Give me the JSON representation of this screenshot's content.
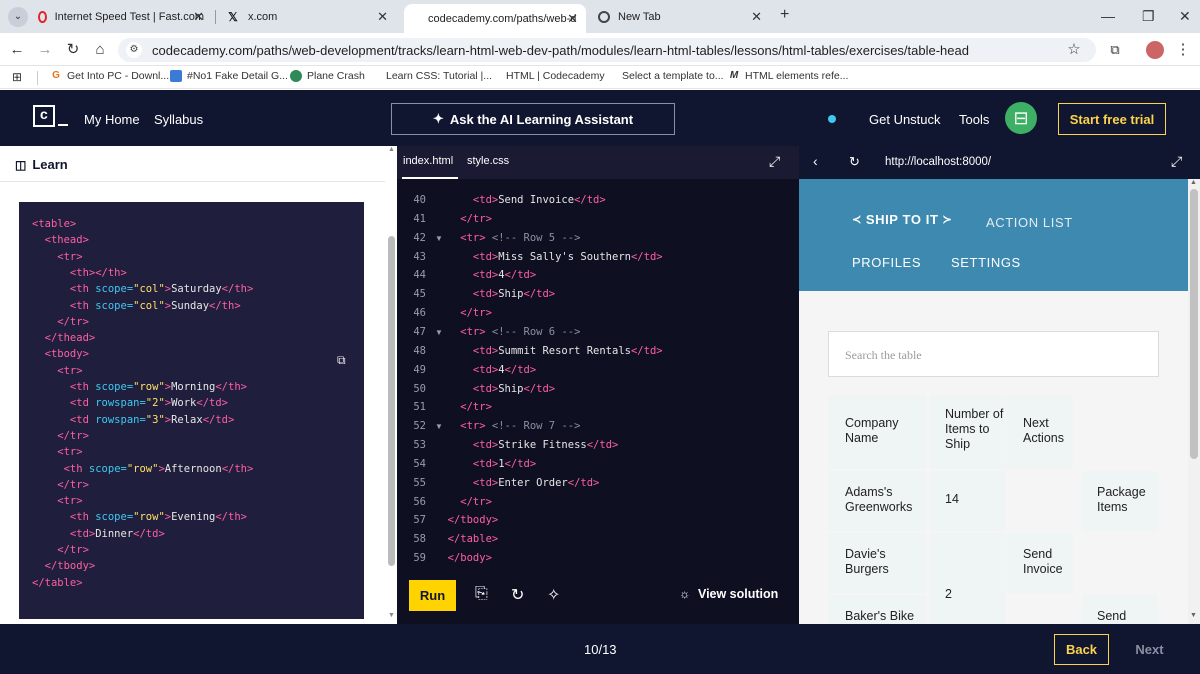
{
  "browser": {
    "tabs": [
      {
        "label": "Internet Speed Test | Fast.com",
        "icon": "fast-com-icon"
      },
      {
        "label": "x.com",
        "icon": "x-logo-icon"
      },
      {
        "label": "codecademy.com/paths/web-d",
        "icon": "codecademy-icon",
        "active": true
      },
      {
        "label": "New Tab",
        "icon": "chrome-icon"
      }
    ],
    "url": "codecademy.com/paths/web-development/tracks/learn-html-web-dev-path/modules/learn-html-tables/lessons/html-tables/exercises/table-head",
    "bookmarks": [
      {
        "label": "Get Into PC - Downl...",
        "icon": "G"
      },
      {
        "label": "#No1 Fake Detail G...",
        "icon": "fake-detail-icon"
      },
      {
        "label": "Plane Crash",
        "icon": "plane-crash-icon"
      },
      {
        "label": "Learn CSS: Tutorial |...",
        "icon": ""
      },
      {
        "label": "HTML | Codecademy",
        "icon": ""
      },
      {
        "label": "Select a template to...",
        "icon": ""
      },
      {
        "label": "HTML elements refe...",
        "icon": "M"
      }
    ]
  },
  "header": {
    "my_home": "My Home",
    "syllabus": "Syllabus",
    "ai_assistant": "Ask the AI Learning Assistant",
    "get_unstuck": "Get Unstuck",
    "tools": "Tools",
    "start_trial": "Start free trial"
  },
  "learn": {
    "title": "Learn",
    "code_lines": [
      [
        [
          "tg",
          "<table>"
        ]
      ],
      [
        [
          "tg",
          "  <thead>"
        ]
      ],
      [
        [
          "tg",
          "    <tr>"
        ]
      ],
      [
        [
          "tg",
          "      <th></th>"
        ]
      ],
      [
        [
          "tg",
          "      <th "
        ],
        [
          "at",
          "scope="
        ],
        [
          "st",
          "\"col\""
        ],
        [
          "tg",
          ">"
        ],
        [
          "tx",
          "Saturday"
        ],
        [
          "tg",
          "</th>"
        ]
      ],
      [
        [
          "tg",
          "      <th "
        ],
        [
          "at",
          "scope="
        ],
        [
          "st",
          "\"col\""
        ],
        [
          "tg",
          ">"
        ],
        [
          "tx",
          "Sunday"
        ],
        [
          "tg",
          "</th>"
        ]
      ],
      [
        [
          "tg",
          "    </tr>"
        ]
      ],
      [
        [
          "tg",
          "  </thead>"
        ]
      ],
      [
        [
          "tg",
          "  <tbody>"
        ]
      ],
      [
        [
          "tg",
          "    <tr>"
        ]
      ],
      [
        [
          "tg",
          "      <th "
        ],
        [
          "at",
          "scope="
        ],
        [
          "st",
          "\"row\""
        ],
        [
          "tg",
          ">"
        ],
        [
          "tx",
          "Morning"
        ],
        [
          "tg",
          "</th>"
        ]
      ],
      [
        [
          "tg",
          "      <td "
        ],
        [
          "at",
          "rowspan="
        ],
        [
          "st",
          "\"2\""
        ],
        [
          "tg",
          ">"
        ],
        [
          "tx",
          "Work"
        ],
        [
          "tg",
          "</td>"
        ]
      ],
      [
        [
          "tg",
          "      <td "
        ],
        [
          "at",
          "rowspan="
        ],
        [
          "st",
          "\"3\""
        ],
        [
          "tg",
          ">"
        ],
        [
          "tx",
          "Relax"
        ],
        [
          "tg",
          "</td>"
        ]
      ],
      [
        [
          "tg",
          "    </tr>"
        ]
      ],
      [
        [
          "tg",
          "    <tr>"
        ]
      ],
      [
        [
          "tg",
          "     <th "
        ],
        [
          "at",
          "scope="
        ],
        [
          "st",
          "\"row\""
        ],
        [
          "tg",
          ">"
        ],
        [
          "tx",
          "Afternoon"
        ],
        [
          "tg",
          "</th>"
        ]
      ],
      [
        [
          "tg",
          "    </tr>"
        ]
      ],
      [
        [
          "tg",
          "    <tr>"
        ]
      ],
      [
        [
          "tg",
          "      <th "
        ],
        [
          "at",
          "scope="
        ],
        [
          "st",
          "\"row\""
        ],
        [
          "tg",
          ">"
        ],
        [
          "tx",
          "Evening"
        ],
        [
          "tg",
          "</th>"
        ]
      ],
      [
        [
          "tg",
          "      <td>"
        ],
        [
          "tx",
          "Dinner"
        ],
        [
          "tg",
          "</td>"
        ]
      ],
      [
        [
          "tg",
          "    </tr>"
        ]
      ],
      [
        [
          "tg",
          "  </tbody>"
        ]
      ],
      [
        [
          "tg",
          "</table>"
        ]
      ]
    ]
  },
  "editor": {
    "tabs": [
      "index.html",
      "style.css"
    ],
    "lines": [
      {
        "n": "40",
        "fold": false,
        "parts": [
          [
            "tg",
            "      <td>"
          ],
          [
            "tx",
            "Send Invoice"
          ],
          [
            "tg",
            "</td>"
          ]
        ]
      },
      {
        "n": "41",
        "fold": false,
        "parts": [
          [
            "tg",
            "    </tr>"
          ]
        ]
      },
      {
        "n": "42",
        "fold": true,
        "parts": [
          [
            "tg",
            "    <tr> "
          ],
          [
            "cm",
            "<!-- Row 5 -->"
          ]
        ]
      },
      {
        "n": "43",
        "fold": false,
        "parts": [
          [
            "tg",
            "      <td>"
          ],
          [
            "tx",
            "Miss Sally's Southern"
          ],
          [
            "tg",
            "</td>"
          ]
        ]
      },
      {
        "n": "44",
        "fold": false,
        "parts": [
          [
            "tg",
            "      <td>"
          ],
          [
            "tx",
            "4"
          ],
          [
            "tg",
            "</td>"
          ]
        ]
      },
      {
        "n": "45",
        "fold": false,
        "parts": [
          [
            "tg",
            "      <td>"
          ],
          [
            "tx",
            "Ship"
          ],
          [
            "tg",
            "</td>"
          ]
        ]
      },
      {
        "n": "46",
        "fold": false,
        "parts": [
          [
            "tg",
            "    </tr>"
          ]
        ]
      },
      {
        "n": "47",
        "fold": true,
        "parts": [
          [
            "tg",
            "    <tr> "
          ],
          [
            "cm",
            "<!-- Row 6 -->"
          ]
        ]
      },
      {
        "n": "48",
        "fold": false,
        "parts": [
          [
            "tg",
            "      <td>"
          ],
          [
            "tx",
            "Summit Resort Rentals"
          ],
          [
            "tg",
            "</td>"
          ]
        ]
      },
      {
        "n": "49",
        "fold": false,
        "parts": [
          [
            "tg",
            "      <td>"
          ],
          [
            "tx",
            "4"
          ],
          [
            "tg",
            "</td>"
          ]
        ]
      },
      {
        "n": "50",
        "fold": false,
        "parts": [
          [
            "tg",
            "      <td>"
          ],
          [
            "tx",
            "Ship"
          ],
          [
            "tg",
            "</td>"
          ]
        ]
      },
      {
        "n": "51",
        "fold": false,
        "parts": [
          [
            "tg",
            "    </tr>"
          ]
        ]
      },
      {
        "n": "52",
        "fold": true,
        "parts": [
          [
            "tg",
            "    <tr> "
          ],
          [
            "cm",
            "<!-- Row 7 -->"
          ]
        ]
      },
      {
        "n": "53",
        "fold": false,
        "parts": [
          [
            "tg",
            "      <td>"
          ],
          [
            "tx",
            "Strike Fitness"
          ],
          [
            "tg",
            "</td>"
          ]
        ]
      },
      {
        "n": "54",
        "fold": false,
        "parts": [
          [
            "tg",
            "      <td>"
          ],
          [
            "tx",
            "1"
          ],
          [
            "tg",
            "</td>"
          ]
        ]
      },
      {
        "n": "55",
        "fold": false,
        "parts": [
          [
            "tg",
            "      <td>"
          ],
          [
            "tx",
            "Enter Order"
          ],
          [
            "tg",
            "</td>"
          ]
        ]
      },
      {
        "n": "56",
        "fold": false,
        "parts": [
          [
            "tg",
            "    </tr>"
          ]
        ]
      },
      {
        "n": "57",
        "fold": false,
        "parts": [
          [
            "tg",
            "  </tbody>"
          ]
        ]
      },
      {
        "n": "58",
        "fold": false,
        "parts": [
          [
            "tg",
            "  </table>"
          ]
        ]
      },
      {
        "n": "59",
        "fold": false,
        "parts": [
          [
            "tg",
            "  </body>"
          ]
        ]
      }
    ],
    "run": "Run",
    "view_solution": "View solution"
  },
  "preview": {
    "url": "http://localhost:8000/",
    "brand": "SHIP TO IT",
    "action_list": "ACTION LIST",
    "profiles": "PROFILES",
    "settings": "SETTINGS",
    "search_placeholder": "Search the table",
    "header": {
      "company": "Company Name",
      "items": "Number of Items to Ship",
      "actions": "Next Actions"
    },
    "rows": [
      {
        "company": "Adams's Greenworks",
        "items": "14",
        "action": "Package Items"
      },
      {
        "company": "Davie's Burgers",
        "items": "2",
        "action": "Send Invoice"
      },
      {
        "company": "Baker's Bike",
        "action": "Send"
      }
    ]
  },
  "footer": {
    "progress": "10/13",
    "back": "Back",
    "next": "Next"
  },
  "colors": {
    "cc_navy": "#10162f",
    "cc_yellow": "#ffd300",
    "ship_blue": "#3d89b0",
    "tag_pink": "#ff5fa2",
    "attr_blue": "#3fc8f0",
    "string_yellow": "#ffe066"
  }
}
